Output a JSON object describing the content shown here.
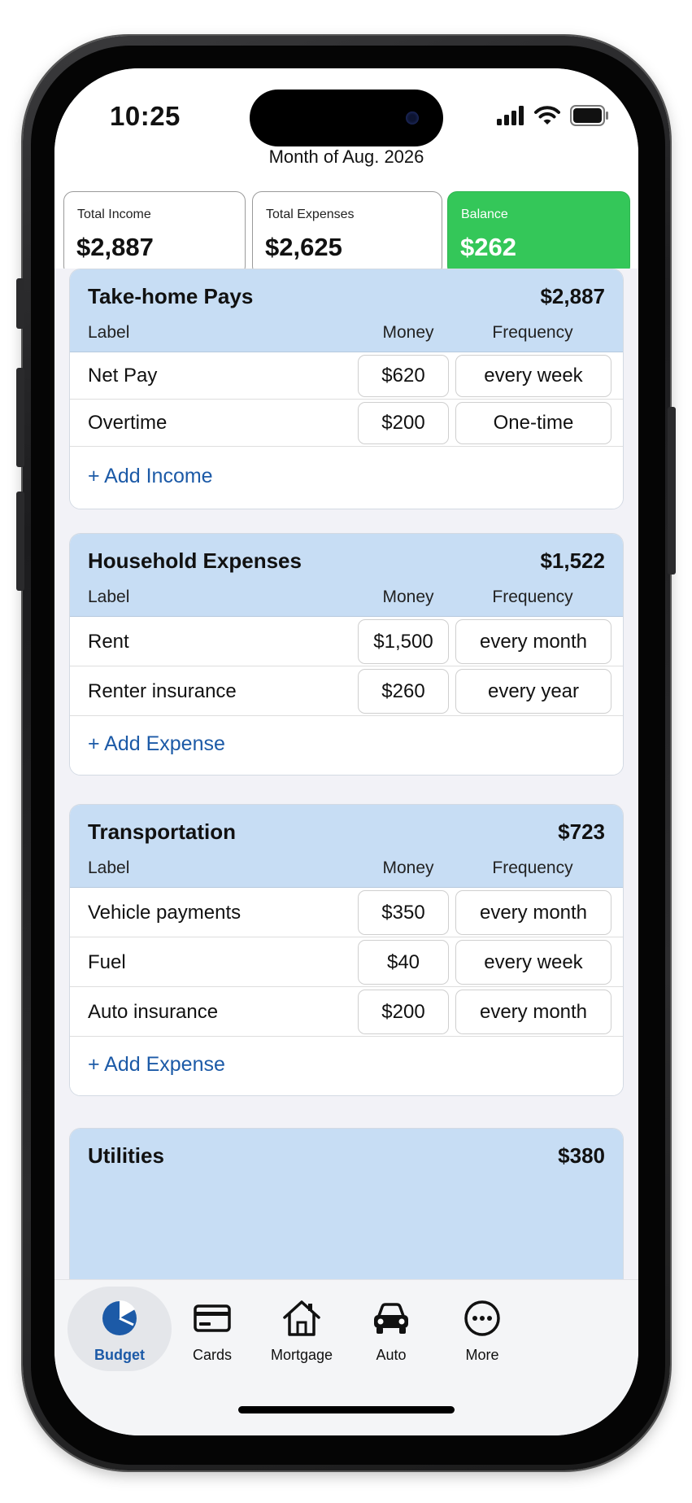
{
  "status_bar": {
    "time": "10:25"
  },
  "header": {
    "month_title": "Month of Aug. 2026"
  },
  "summary": {
    "income": {
      "label": "Total Income",
      "value": "$2,887"
    },
    "expenses": {
      "label": "Total Expenses",
      "value": "$2,625"
    },
    "balance": {
      "label": "Balance",
      "value": "$262"
    }
  },
  "columns": {
    "label": "Label",
    "money": "Money",
    "frequency": "Frequency"
  },
  "sections": [
    {
      "title": "Take-home Pays",
      "total": "$2,887",
      "rows": [
        {
          "label": "Net Pay",
          "money": "$620",
          "frequency": "every week"
        },
        {
          "label": "Overtime",
          "money": "$200",
          "frequency": "One-time"
        }
      ],
      "add_label": "+ Add Income"
    },
    {
      "title": "Household Expenses",
      "total": "$1,522",
      "rows": [
        {
          "label": "Rent",
          "money": "$1,500",
          "frequency": "every month"
        },
        {
          "label": "Renter insurance",
          "money": "$260",
          "frequency": "every year"
        }
      ],
      "add_label": "+ Add Expense"
    },
    {
      "title": "Transportation",
      "total": "$723",
      "rows": [
        {
          "label": "Vehicle payments",
          "money": "$350",
          "frequency": "every month"
        },
        {
          "label": "Fuel",
          "money": "$40",
          "frequency": "every week"
        },
        {
          "label": "Auto insurance",
          "money": "$200",
          "frequency": "every month"
        }
      ],
      "add_label": "+ Add Expense"
    },
    {
      "title": "Utilities",
      "total": "$380",
      "rows": [],
      "add_label": ""
    }
  ],
  "tabs": [
    {
      "label": "Budget",
      "icon": "pie-chart-icon",
      "active": true
    },
    {
      "label": "Cards",
      "icon": "credit-card-icon",
      "active": false
    },
    {
      "label": "Mortgage",
      "icon": "house-icon",
      "active": false
    },
    {
      "label": "Auto",
      "icon": "car-icon",
      "active": false
    },
    {
      "label": "More",
      "icon": "more-icon",
      "active": false
    }
  ],
  "colors": {
    "accent": "#1c5aa7",
    "balance_green": "#34c759",
    "section_header": "#c7ddf4"
  }
}
